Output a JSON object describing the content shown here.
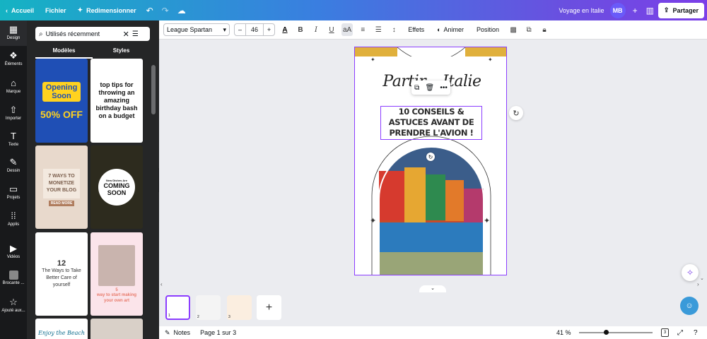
{
  "topbar": {
    "home_label": "Accueil",
    "file_label": "Fichier",
    "resize_label": "Redimensionner",
    "project_title": "Voyage en Italie",
    "avatar_initials": "MB",
    "share_label": "Partager"
  },
  "siderail": {
    "items": [
      {
        "label": "Design",
        "icon": "design-icon"
      },
      {
        "label": "Éléments",
        "icon": "elements-icon"
      },
      {
        "label": "Marque",
        "icon": "brand-icon"
      },
      {
        "label": "Importer",
        "icon": "upload-icon"
      },
      {
        "label": "Texte",
        "icon": "text-icon"
      },
      {
        "label": "Dessin",
        "icon": "draw-icon"
      },
      {
        "label": "Projets",
        "icon": "folder-icon"
      },
      {
        "label": "Applis",
        "icon": "apps-icon"
      },
      {
        "label": "Vidéos",
        "icon": "video-icon"
      },
      {
        "label": "Brocante ...",
        "icon": "brocante-icon"
      },
      {
        "label": "Ajouté aux...",
        "icon": "star-icon"
      }
    ]
  },
  "panel": {
    "search_value": "Utilisés récemment",
    "tabs": [
      "Modèles",
      "Styles"
    ],
    "templates": [
      {
        "title": "Opening Soon",
        "sub": "50% OFF"
      },
      {
        "title": "top tips for throwing an amazing birthday bash on a budget",
        "sub": ""
      },
      {
        "title": "7 WAYS TO MONETIZE YOUR BLOG",
        "sub": "READ MORE"
      },
      {
        "title": "COMING SOON",
        "sub": "New Dishes Are"
      },
      {
        "title": "The Ways to Take Better Care of yourself",
        "sub": "12"
      },
      {
        "title": "way to start making your own art",
        "sub": "5"
      },
      {
        "title": "Enjoy the Beach",
        "sub": ""
      }
    ]
  },
  "toolbar": {
    "font_name": "League Spartan",
    "font_size": "46",
    "minus": "–",
    "plus": "+",
    "effects_label": "Effets",
    "animate_label": "Animer",
    "position_label": "Position"
  },
  "canvas": {
    "script_title": "Partir... Italie",
    "headline": "10 CONSEILS & ASTUCES AVANT DE PRENDRE L'AVION !"
  },
  "pages": {
    "thumbs": [
      {
        "number": "1"
      },
      {
        "number": "2"
      },
      {
        "number": "3"
      }
    ]
  },
  "statusbar": {
    "notes_label": "Notes",
    "page_info": "Page 1 sur 3",
    "zoom_label": "41 %",
    "page_count": "3",
    "zoom_slider_level": 0.37
  },
  "colors": {
    "accent": "#8b3dff",
    "gold": "#e0b03c"
  }
}
